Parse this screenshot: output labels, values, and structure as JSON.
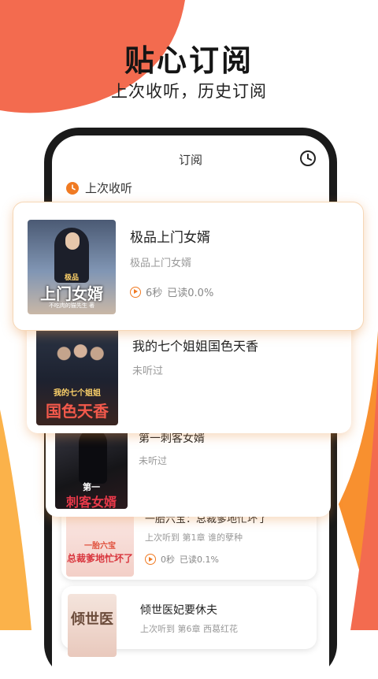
{
  "header": {
    "title": "贴心订阅",
    "subtitle": "上次收听，历史订阅"
  },
  "screen": {
    "title": "订阅",
    "section_label": "上次收听"
  },
  "icons": {
    "history": "clock-icon",
    "section": "clock-icon",
    "play": "play-circle-icon"
  },
  "colors": {
    "accent": "#f07a22",
    "coral": "#f36b4f",
    "background_orange": "#f9a24a"
  },
  "books": [
    {
      "title": "极品上门女婿",
      "subtitle": "极品上门女婿",
      "duration": "6秒",
      "progress": "已读0.0%",
      "cover_badge": "极品",
      "cover_title": "上门女婿",
      "cover_author": "不吃肉的猫先生 著"
    },
    {
      "title": "我的七个姐姐国色天香",
      "subtitle": "未听过",
      "cover_badge": "我的七个姐姐",
      "cover_title": "国色天香"
    },
    {
      "title": "第一刺客女婿",
      "subtitle": "未听过",
      "cover_badge": "第一",
      "cover_title": "刺客女婿"
    },
    {
      "title": "一胎六宝：总裁爹地忙坏了",
      "subtitle": "上次听到 第1章 谁的孽种",
      "duration": "0秒",
      "progress": "已读0.1%",
      "cover_badge": "一胎六宝",
      "cover_title": "总裁爹地忙坏了"
    },
    {
      "title": "倾世医妃要休夫",
      "subtitle": "上次听到 第6章 西葛红花",
      "cover_badge": "",
      "cover_title": "倾世医"
    }
  ]
}
